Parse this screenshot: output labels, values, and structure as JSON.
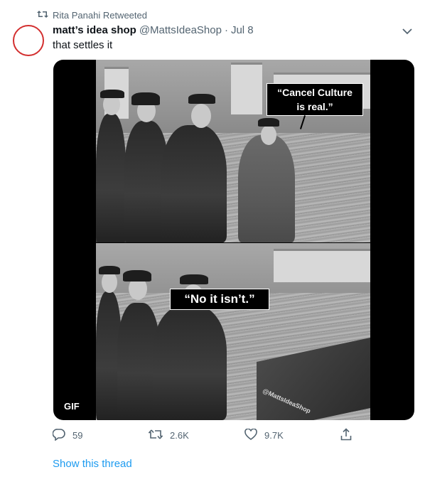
{
  "retweet_banner": {
    "text": "Rita Panahi Retweeted",
    "icon": "retweet-icon"
  },
  "tweet": {
    "display_name": "matt’s idea shop",
    "handle": "@MattsIdeaShop",
    "separator": "·",
    "date": "Jul 8",
    "text": "that settles it",
    "media": {
      "type": "GIF",
      "badge": "GIF",
      "caption_top": "“Cancel Culture is real.”",
      "caption_bottom": "“No it isn’t.”",
      "watermark": "@MattsIdeaShop"
    },
    "actions": {
      "replies": "59",
      "retweets": "2.6K",
      "likes": "9.7K"
    }
  },
  "show_thread": "Show this thread",
  "colors": {
    "accent": "#1d9bf0",
    "secondary_text": "#536471",
    "avatar_ring": "#d32f2f"
  }
}
